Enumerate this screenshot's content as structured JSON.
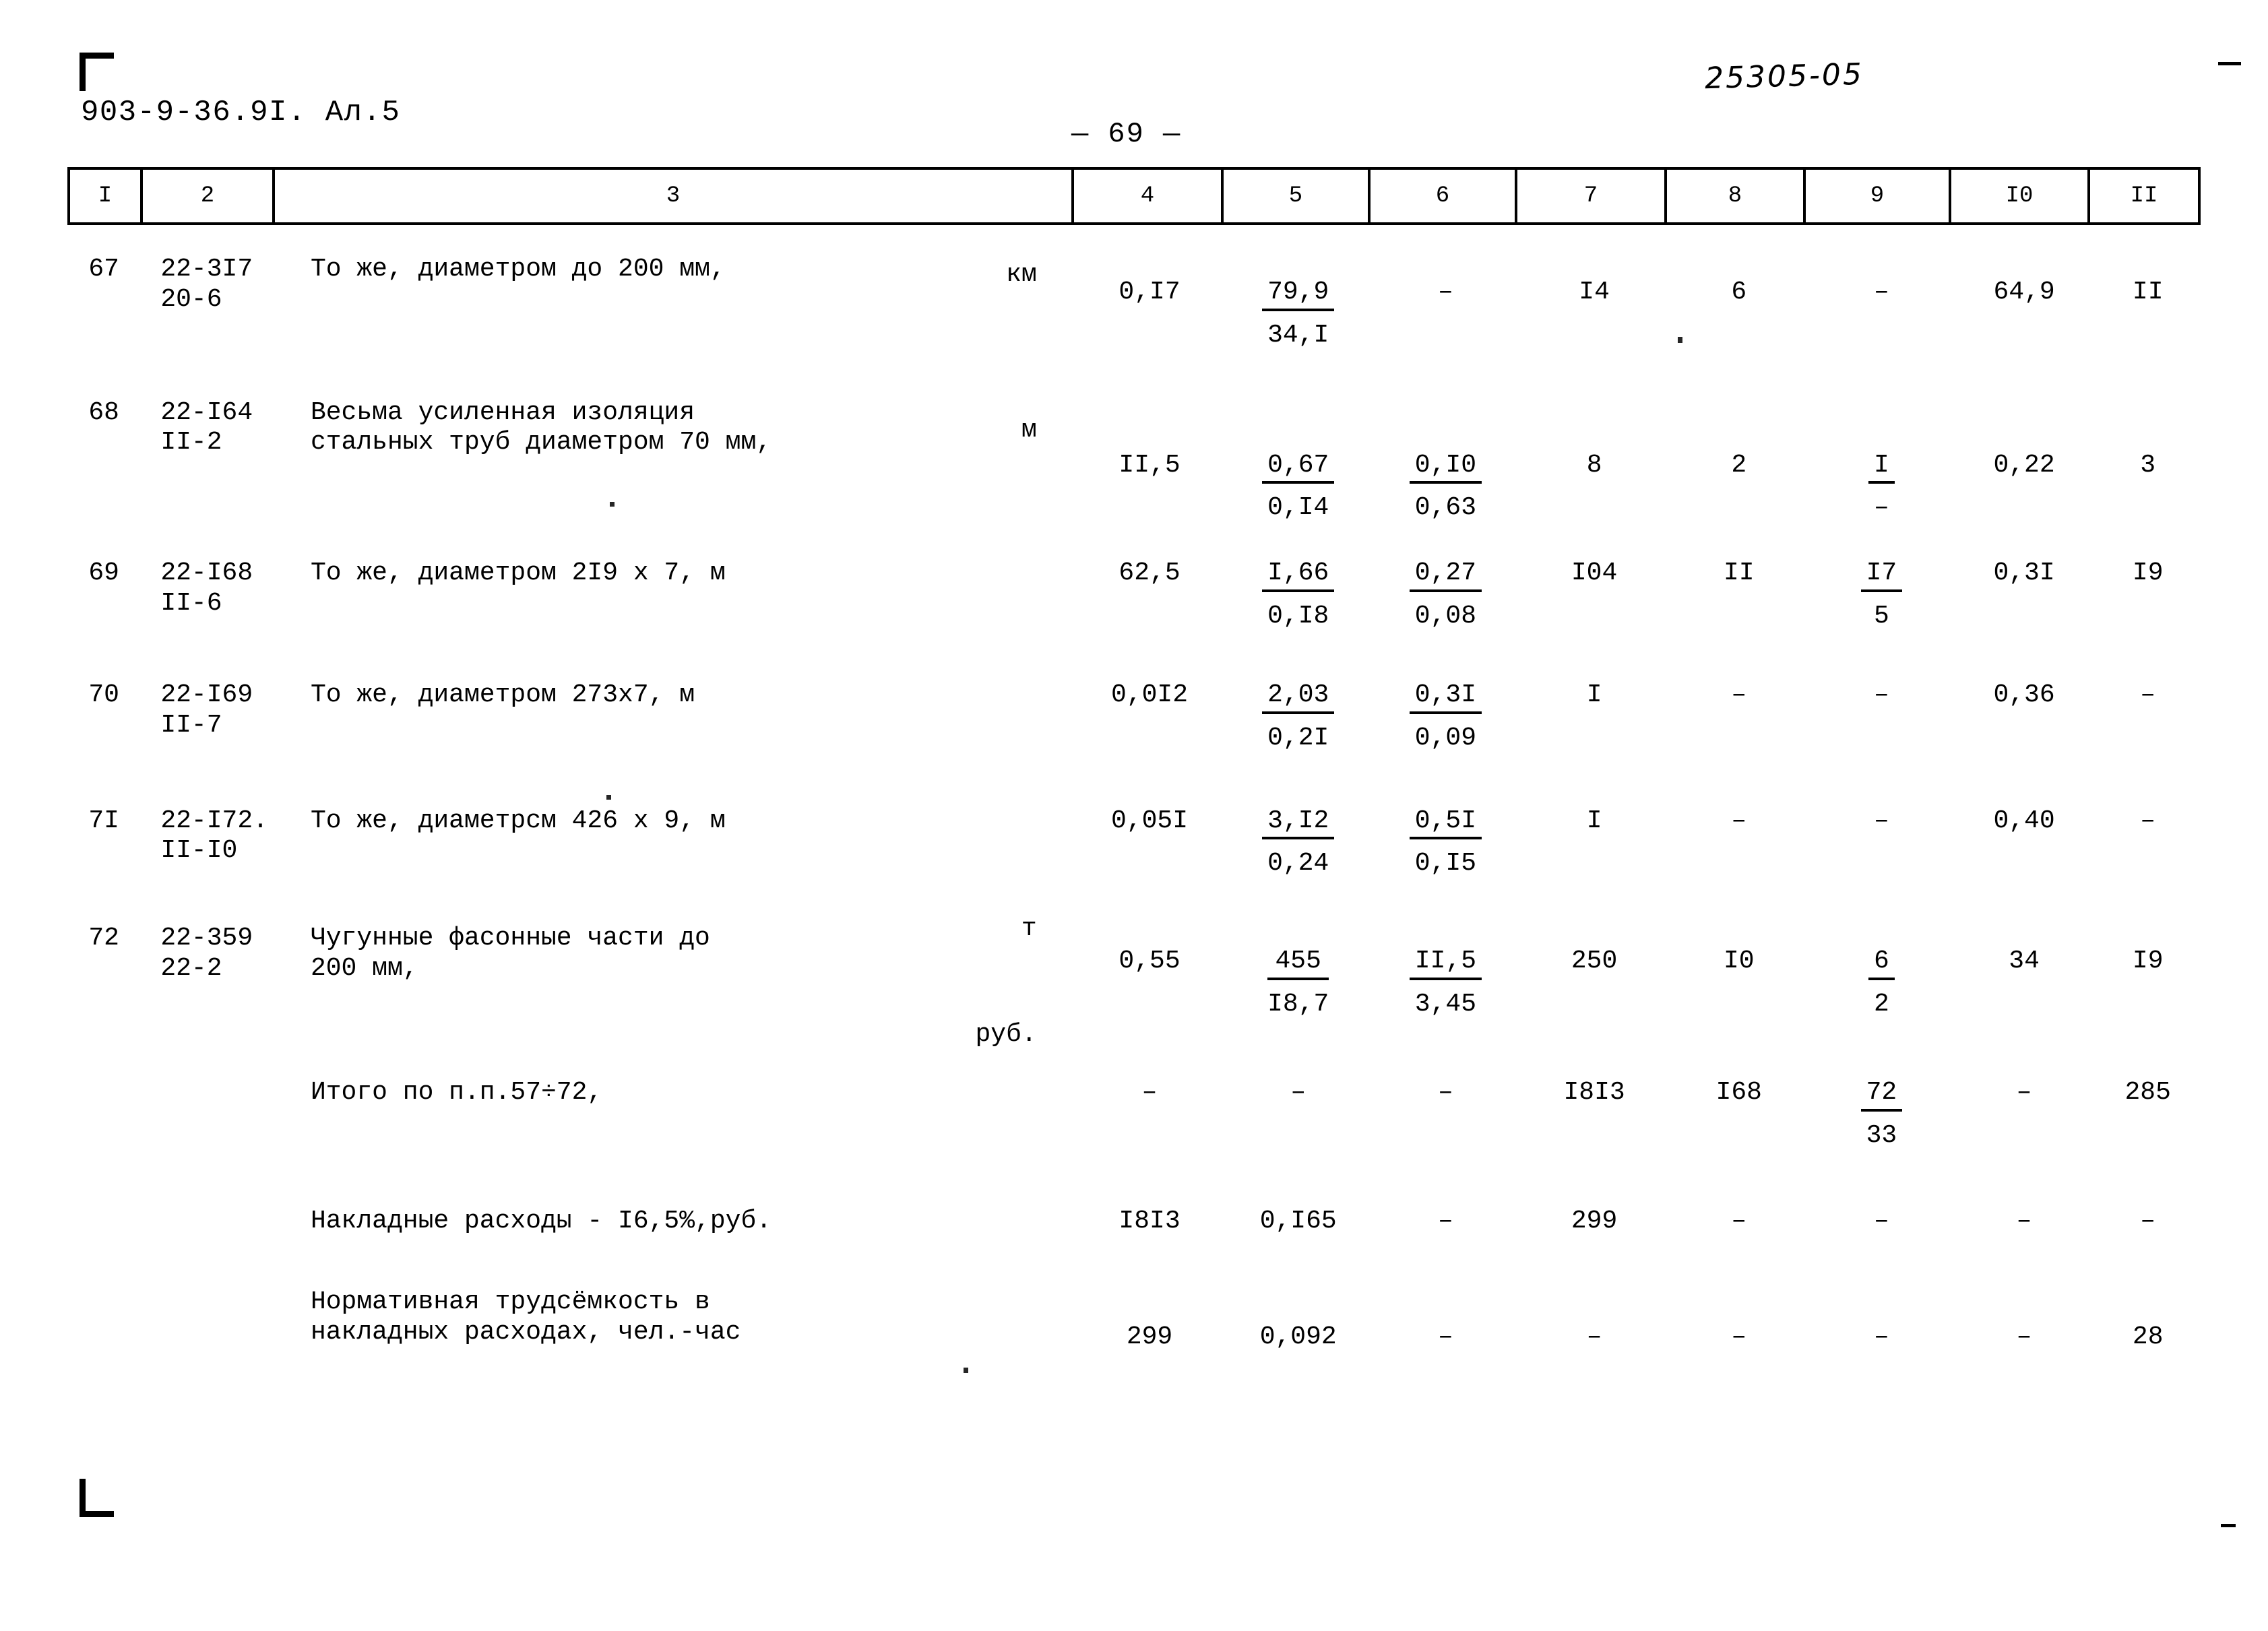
{
  "page": {
    "doc_code": "903-9-36.9I. Ал.5",
    "scan_number": "25305-05",
    "page_number": "— 69 —"
  },
  "table": {
    "column_headers": [
      "I",
      "2",
      "3",
      "4",
      "5",
      "6",
      "7",
      "8",
      "9",
      "I0",
      "II"
    ],
    "rows": [
      {
        "no": "67",
        "code": "22-3I7\n20-6",
        "desc_lines": [
          "То же, диаметром до 200 мм,"
        ],
        "unit": "км",
        "c4": "0,I7",
        "c5_num": "79,9",
        "c5_den": "34,I",
        "c6": "–",
        "c7": "I4",
        "c8": "6",
        "c9": "–",
        "c10": "64,9",
        "c11": "II"
      },
      {
        "no": "68",
        "code": "22-I64\nII-2",
        "desc_lines": [
          "Весьма усиленная изоляция",
          "стальных труб диаметром 70 мм,"
        ],
        "unit": "м",
        "c4": "II,5",
        "c5_num": "0,67",
        "c5_den": "0,I4",
        "c6_num": "0,I0",
        "c6_den": "0,63",
        "c7": "8",
        "c8": "2",
        "c9_num": "I",
        "c9_den": "–",
        "c10": "0,22",
        "c11": "3"
      },
      {
        "no": "69",
        "code": "22-I68\nII-6",
        "desc_lines": [
          "То же, диаметром 2I9 х 7, м"
        ],
        "unit": "",
        "c4": "62,5",
        "c5_num": "I,66",
        "c5_den": "0,I8",
        "c6_num": "0,27",
        "c6_den": "0,08",
        "c7": "I04",
        "c8": "II",
        "c9_num": "I7",
        "c9_den": "5",
        "c10": "0,3I",
        "c11": "I9"
      },
      {
        "no": "70",
        "code": "22-I69\nII-7",
        "desc_lines": [
          "То же, диаметром 273х7,    м"
        ],
        "unit": "",
        "c4": "0,0I2",
        "c5_num": "2,03",
        "c5_den": "0,2I",
        "c6_num": "0,3I",
        "c6_den": "0,09",
        "c7": "I",
        "c8": "–",
        "c9": "–",
        "c10": "0,36",
        "c11": "–"
      },
      {
        "no": "7I",
        "code": "22-I72.\nII-I0",
        "desc_lines": [
          "То же, диаметрсм 426 х 9, м"
        ],
        "unit": "",
        "c4": "0,05I",
        "c5_num": "3,I2",
        "c5_den": "0,24",
        "c6_num": "0,5I",
        "c6_den": "0,I5",
        "c7": "I",
        "c8": "–",
        "c9": "–",
        "c10": "0,40",
        "c11": "–"
      },
      {
        "no": "72",
        "code": "22-359\n22-2",
        "desc_lines": [
          "Чугунные фасонные части до",
          "200 мм,"
        ],
        "unit": "т",
        "c4": "0,55",
        "c5_num": "455",
        "c5_den": "I8,7",
        "c6_num": "II,5",
        "c6_den": "3,45",
        "c7": "250",
        "c8": "I0",
        "c9_num": "6",
        "c9_den": "2",
        "c10": "34",
        "c11": "I9"
      }
    ],
    "summary_rows": [
      {
        "no": "",
        "code": "",
        "desc_lines": [
          "Итого по п.п.57÷72,"
        ],
        "unit": "руб.",
        "c4": "–",
        "c5": "–",
        "c6": "–",
        "c7": "I8I3",
        "c8": "I68",
        "c9_num": "72",
        "c9_den": "33",
        "c10": "–",
        "c11": "285"
      },
      {
        "no": "",
        "code": "",
        "desc_lines": [
          "Накладные расходы - I6,5%,руб."
        ],
        "unit": "",
        "c4": "I8I3",
        "c5": "0,I65",
        "c6": "–",
        "c7": "299",
        "c8": "–",
        "c9": "–",
        "c10": "–",
        "c11": "–"
      },
      {
        "no": "",
        "code": "",
        "desc_lines": [
          "Нормативная трудсёмкость в",
          "накладных расходах,   чел.-час"
        ],
        "unit": "",
        "c4": "299",
        "c5": "0,092",
        "c6": "–",
        "c7": "–",
        "c8": "–",
        "c9": "–",
        "c10": "–",
        "c11": "28"
      }
    ]
  }
}
